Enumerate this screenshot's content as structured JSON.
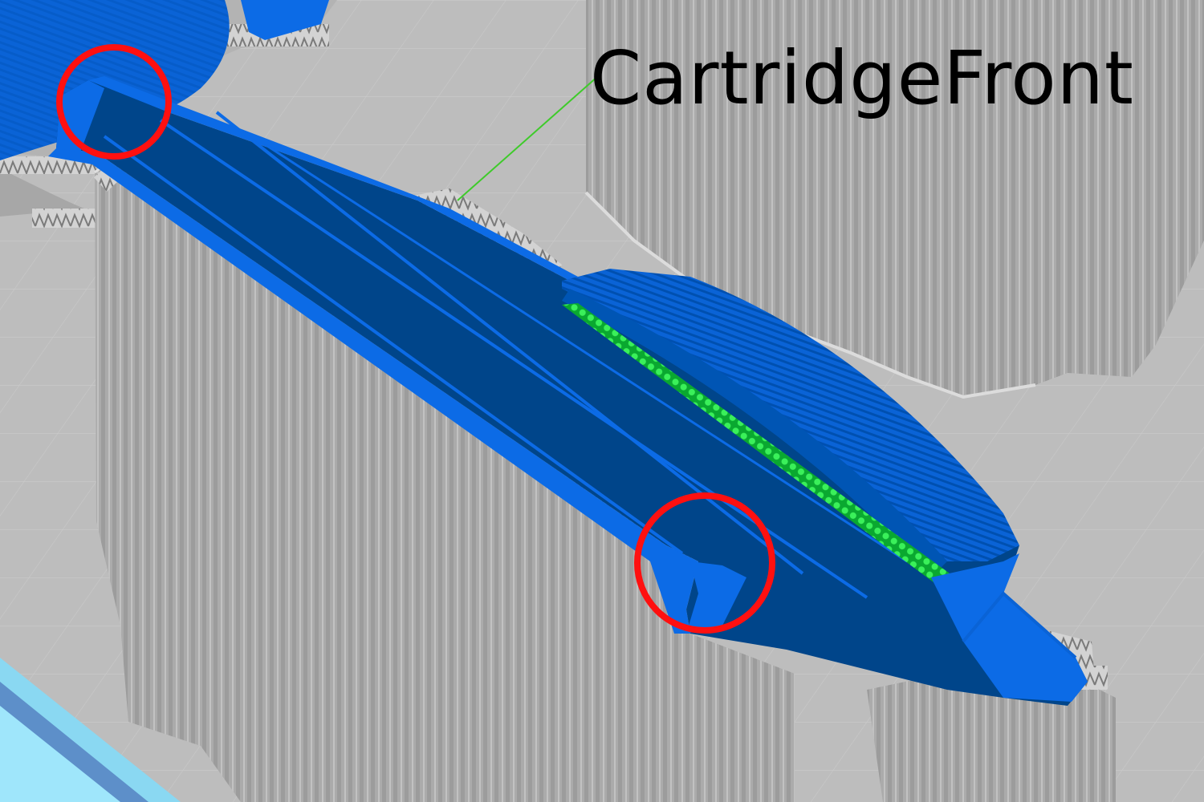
{
  "viewer": {
    "object_label": "CartridgeFront",
    "annotation_count": 2
  },
  "colors": {
    "background": "#bdbdbd",
    "support": "#a9a9a9",
    "support_dark": "#8f8f8f",
    "part_dark": "#00458a",
    "part_mid": "#0055b4",
    "part_bright": "#0c6be6",
    "infill": "#19d23a",
    "highlight": "#ff1010",
    "bed_edge": "#8ad8f2",
    "leader_line": "#3ecb2a"
  }
}
